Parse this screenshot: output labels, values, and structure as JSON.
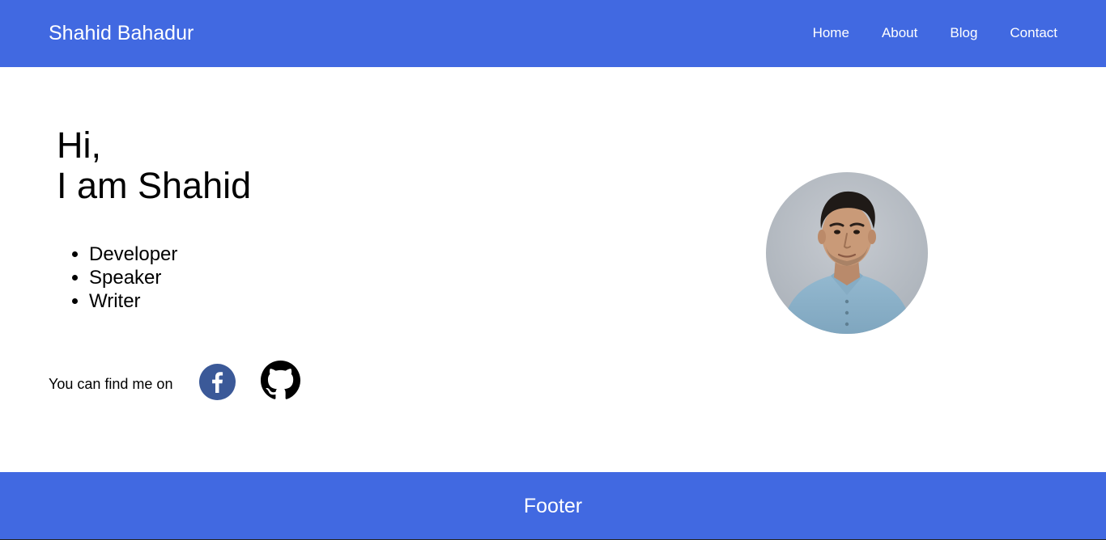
{
  "header": {
    "brand": "Shahid Bahadur",
    "nav": [
      {
        "label": "Home"
      },
      {
        "label": "About"
      },
      {
        "label": "Blog"
      },
      {
        "label": "Contact"
      }
    ]
  },
  "hero": {
    "greeting_line1": "Hi,",
    "greeting_line2": "I am Shahid",
    "roles": [
      "Developer",
      "Speaker",
      "Writer"
    ],
    "find_me_label": "You can find me on",
    "social": [
      {
        "icon": "facebook-icon",
        "color": "#3b5998"
      },
      {
        "icon": "github-icon",
        "color": "#000000"
      }
    ]
  },
  "profile": {
    "photo": "profile-photo"
  },
  "footer": {
    "text": "Footer"
  },
  "colors": {
    "accent": "#4169e1",
    "text": "#000000",
    "on_accent": "#ffffff"
  }
}
